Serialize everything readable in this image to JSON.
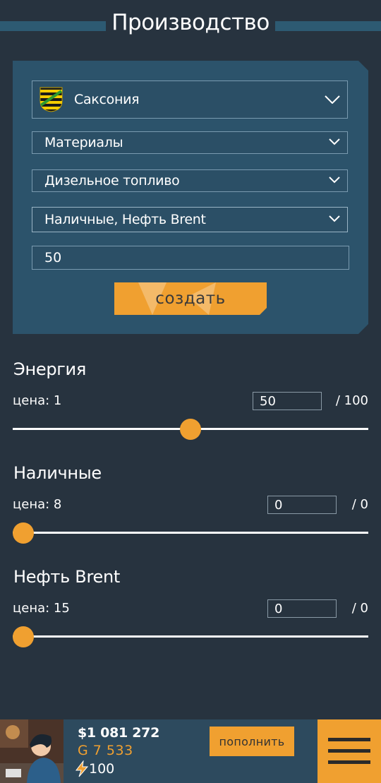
{
  "header": {
    "title": "Производство"
  },
  "form": {
    "region": {
      "value": "Саксония",
      "flag_icon": "saxony-flag-icon"
    },
    "category": {
      "value": "Материалы"
    },
    "product": {
      "value": "Дизельное топливо"
    },
    "resources": {
      "value": "Наличные, Нефть Brent"
    },
    "quantity": {
      "value": "50"
    },
    "create_label": "создать"
  },
  "resources": [
    {
      "name": "Энергия",
      "price_label": "цена: 1",
      "amount": "50",
      "max": "/ 100",
      "level": 0.5
    },
    {
      "name": "Наличные",
      "price_label": "цена: 8",
      "amount": "0",
      "max": "/ 0",
      "level": 0
    },
    {
      "name": "Нефть Brent",
      "price_label": "цена: 15",
      "amount": "0",
      "max": "/ 0",
      "level": 0
    }
  ],
  "footer": {
    "money": "$1 081 272",
    "gold": "G 7 533",
    "energy": "100",
    "topup_label": "пополнить"
  },
  "colors": {
    "accent": "#f0a030",
    "background": "#27333f",
    "panel": "#2c536b"
  }
}
